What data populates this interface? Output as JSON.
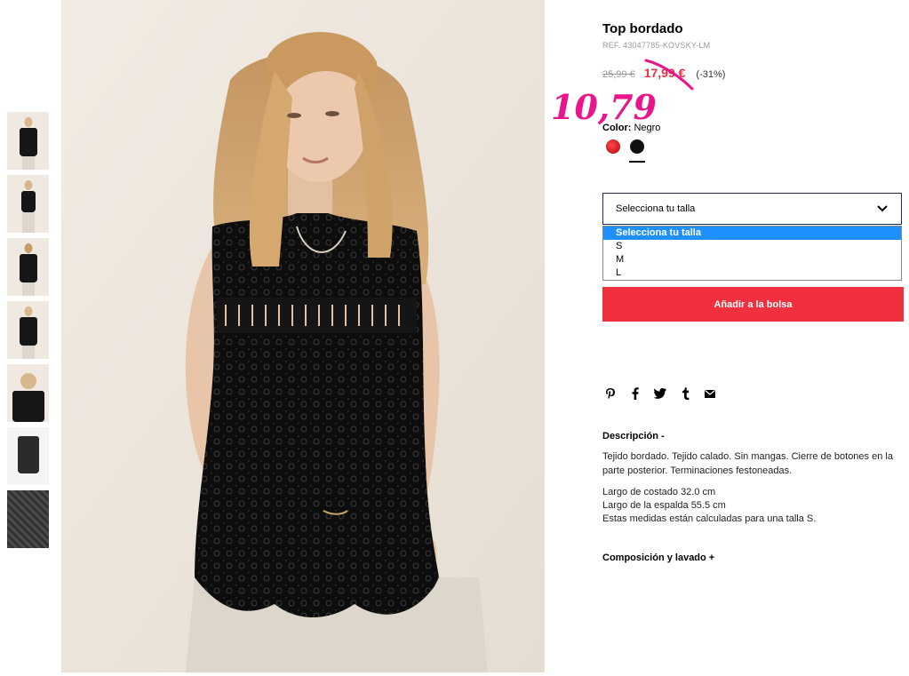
{
  "gallery": {
    "thumbnails": [
      "thumb-1",
      "thumb-2",
      "thumb-3",
      "thumb-4",
      "thumb-5",
      "thumb-6",
      "thumb-7"
    ]
  },
  "product": {
    "title": "Top bordado",
    "ref": "REF. 43047785-KOVSKY-LM",
    "old_price": "25,99 €",
    "new_price": "17,99 €",
    "discount": "(-31%)",
    "handwritten_price": "10,79",
    "color_label": "Color:",
    "color_value": "Negro",
    "colors": [
      "#cc1020",
      "#111111"
    ]
  },
  "size": {
    "placeholder": "Selecciona tu talla",
    "options": [
      "Selecciona tu talla",
      "S",
      "M",
      "L"
    ]
  },
  "actions": {
    "add_to_bag": "Añadir a la bolsa"
  },
  "share": {
    "icons": [
      "pinterest-icon",
      "facebook-icon",
      "twitter-icon",
      "tumblr-icon",
      "mail-icon"
    ]
  },
  "description": {
    "title": "Descripción  -",
    "text1": "Tejido bordado. Tejido calado. Sin mangas. Cierre de botones en la parte posterior. Terminaciones festoneadas.",
    "line1": "Largo de costado 32.0 cm",
    "line2": "Largo de la espalda 55.5 cm",
    "line3": "Estas medidas están calculadas para una talla S."
  },
  "composition": {
    "title": "Composición y lavado  +"
  }
}
